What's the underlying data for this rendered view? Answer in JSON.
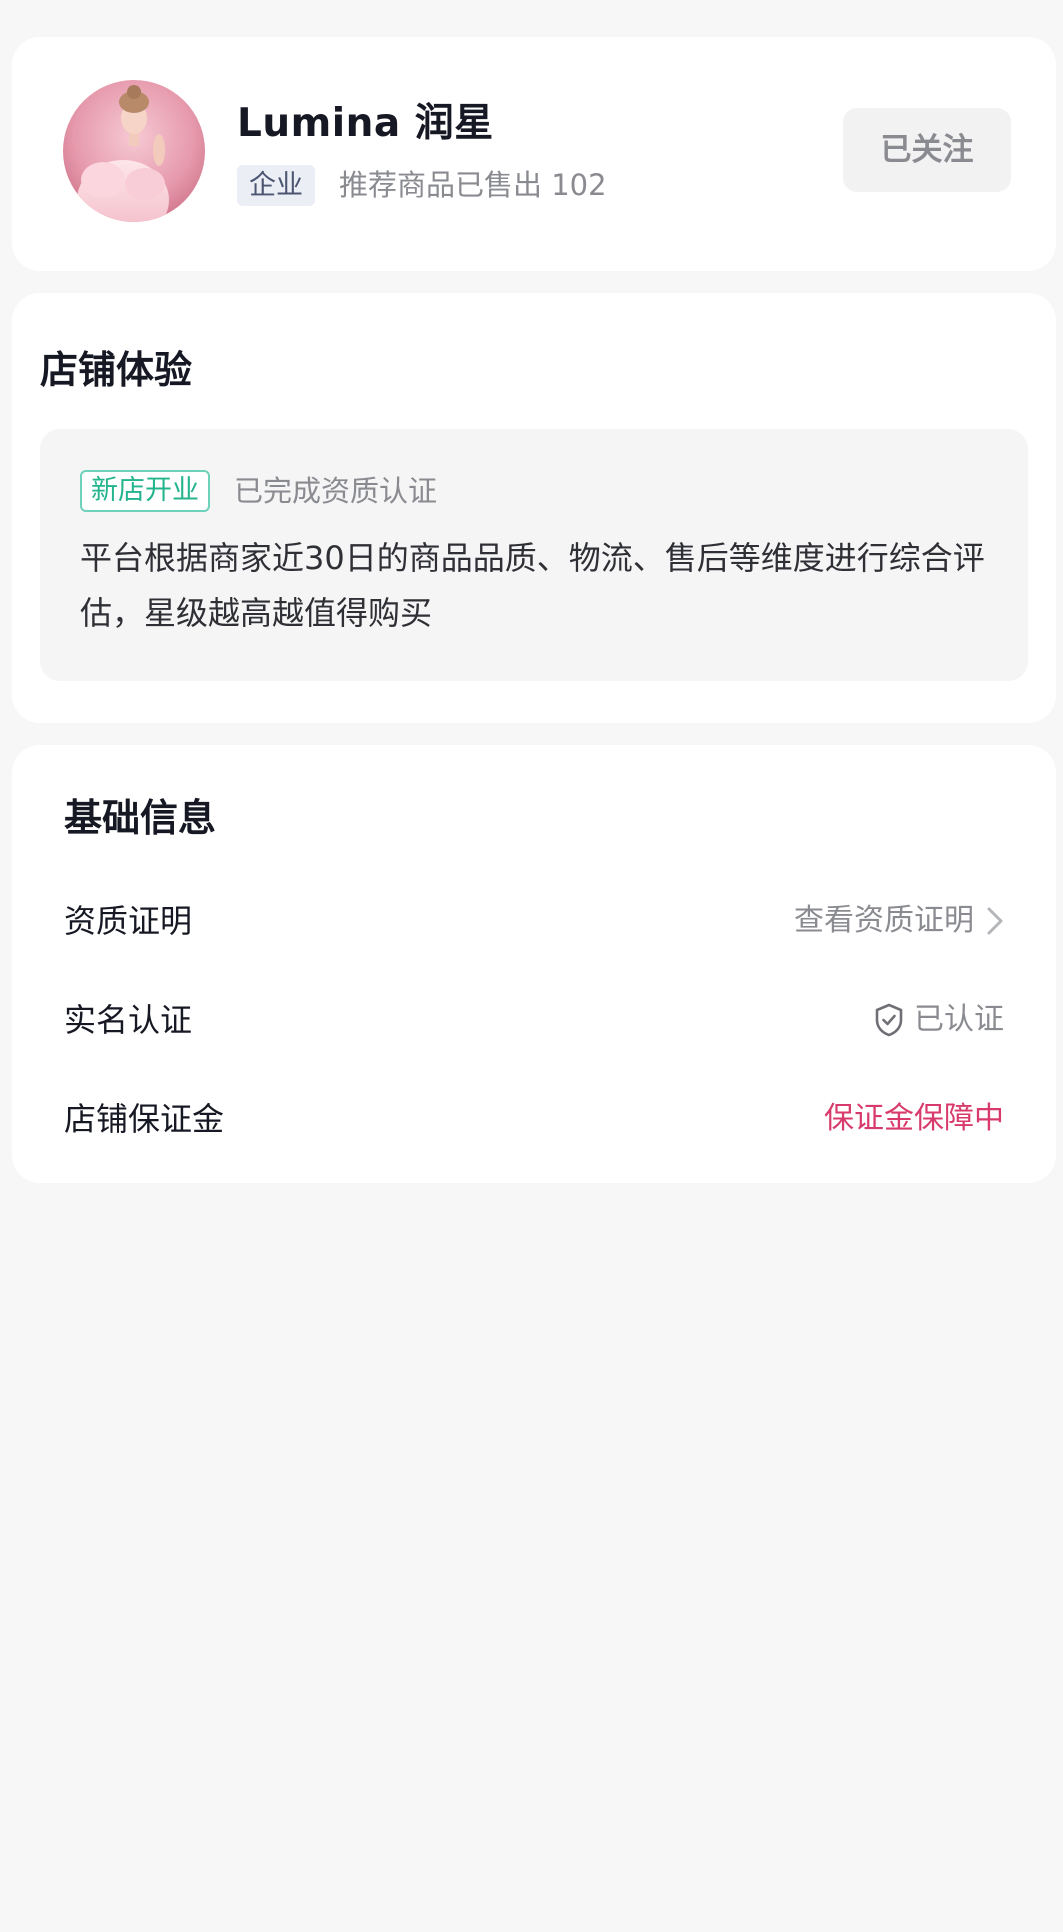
{
  "profile": {
    "shop_name": "Lumina 润星",
    "badge": "企业",
    "sold_text": "推荐商品已售出 102",
    "follow_label": "已关注"
  },
  "experience": {
    "title": "店铺体验",
    "tag": "新店开业",
    "status": "已完成资质认证",
    "description": "平台根据商家近30日的商品品质、物流、售后等维度进行综合评估，星级越高越值得购买"
  },
  "basic_info": {
    "title": "基础信息",
    "rows": [
      {
        "label": "资质证明",
        "value": "查看资质证明",
        "icon": "chevron-right-icon"
      },
      {
        "label": "实名认证",
        "value": "已认证",
        "icon": "shield-check-icon"
      },
      {
        "label": "店铺保证金",
        "value": "保证金保障中"
      }
    ]
  },
  "colors": {
    "background": "#f7f7f7",
    "card": "#ffffff",
    "new_store_green": "#24b48e",
    "deposit_pink": "#d83b6b",
    "secondary_text": "#8a8b91"
  }
}
